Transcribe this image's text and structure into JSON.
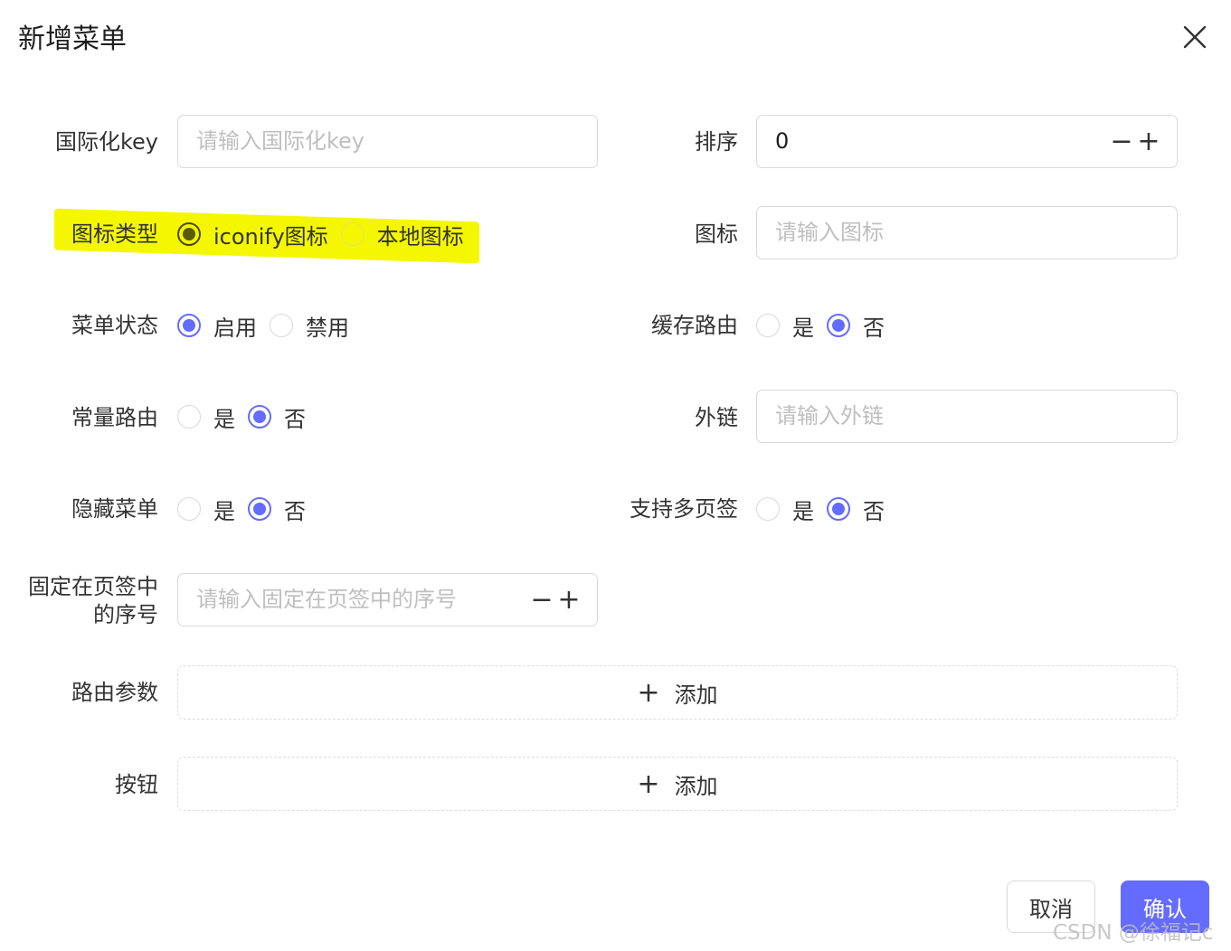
{
  "dialog": {
    "title": "新增菜单"
  },
  "form": {
    "i18n_key": {
      "label": "国际化key",
      "placeholder": "请输入国际化key"
    },
    "order": {
      "label": "排序",
      "value": "0",
      "decrement": "−",
      "increment": "+"
    },
    "icon_type": {
      "label": "图标类型",
      "options": [
        "iconify图标",
        "本地图标"
      ],
      "selected": "iconify图标"
    },
    "icon": {
      "label": "图标",
      "placeholder": "请输入图标"
    },
    "menu_status": {
      "label": "菜单状态",
      "options": [
        "启用",
        "禁用"
      ],
      "selected": "启用"
    },
    "cache_route": {
      "label": "缓存路由",
      "options": [
        "是",
        "否"
      ],
      "selected": "否"
    },
    "constant_route": {
      "label": "常量路由",
      "options": [
        "是",
        "否"
      ],
      "selected": "否"
    },
    "external_link": {
      "label": "外链",
      "placeholder": "请输入外链"
    },
    "hide_menu": {
      "label": "隐藏菜单",
      "options": [
        "是",
        "否"
      ],
      "selected": "否"
    },
    "multi_tab": {
      "label": "支持多页签",
      "options": [
        "是",
        "否"
      ],
      "selected": "否"
    },
    "fixed_tab_order": {
      "label_line1": "固定在页签中",
      "label_line2": "的序号",
      "placeholder": "请输入固定在页签中的序号",
      "decrement": "−",
      "increment": "+"
    },
    "route_params": {
      "label": "路由参数",
      "add_label": "添加",
      "add_icon": "+"
    },
    "buttons": {
      "label": "按钮",
      "add_label": "添加",
      "add_icon": "+"
    }
  },
  "footer": {
    "cancel_label": "取消",
    "confirm_label": "确认"
  },
  "watermark": "CSDN @徐福记c",
  "colors": {
    "accent": "#646cff",
    "highlight": "#f5f700",
    "border": "#d9d9d9",
    "placeholder": "#bfbfbf"
  },
  "icons": [
    "close-icon",
    "plus-icon",
    "minus-icon"
  ]
}
